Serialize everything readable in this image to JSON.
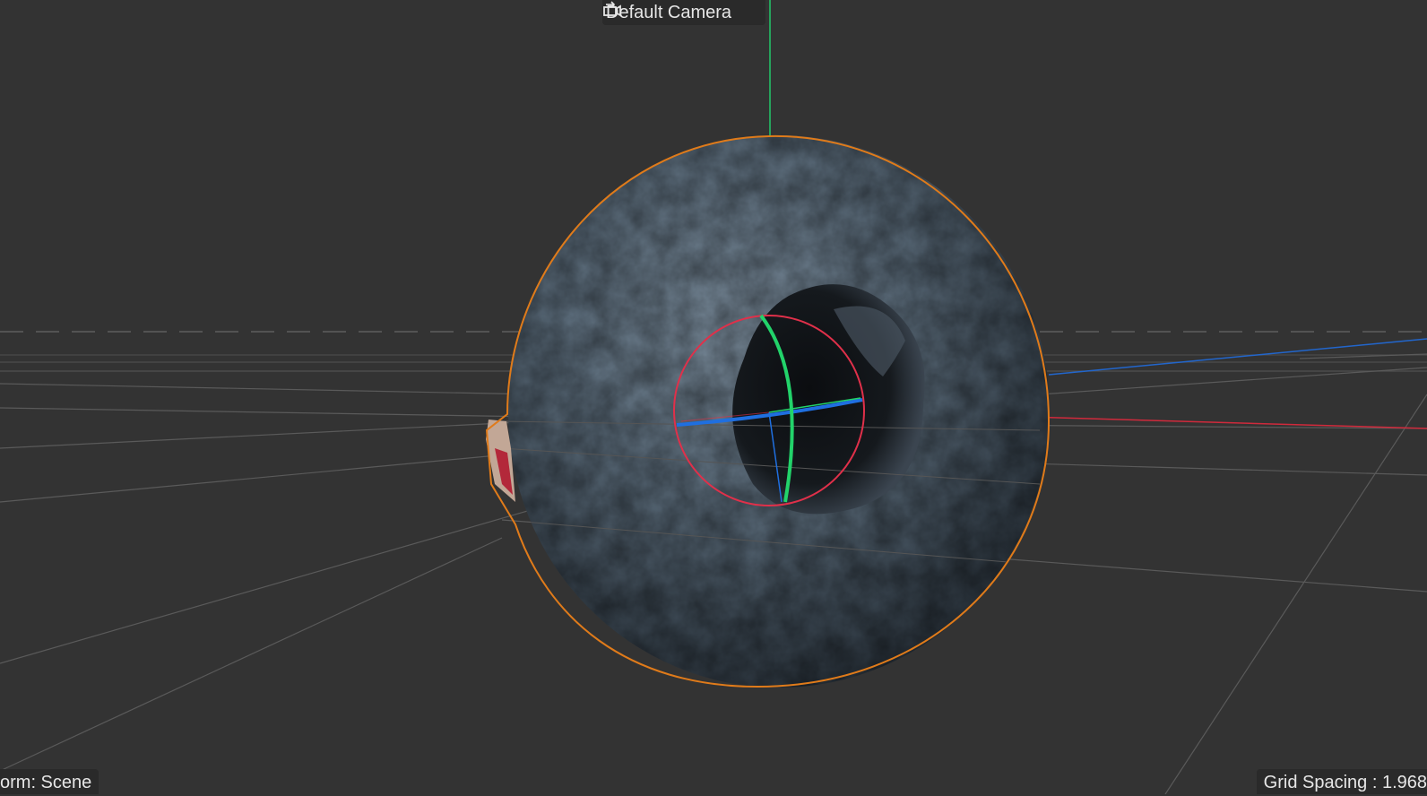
{
  "viewport": {
    "camera_label": "Default Camera",
    "camera_icon": "camera-switch-icon",
    "transform_space": "orm: Scene",
    "grid_spacing": "Grid Spacing : 1.968",
    "colors": {
      "background": "#333333",
      "selection_outline": "#e07b1a",
      "axis_x": "#e0304a",
      "axis_y": "#22d36a",
      "axis_z": "#1f6fe0",
      "sphere_base": "#5a6b7a"
    }
  }
}
